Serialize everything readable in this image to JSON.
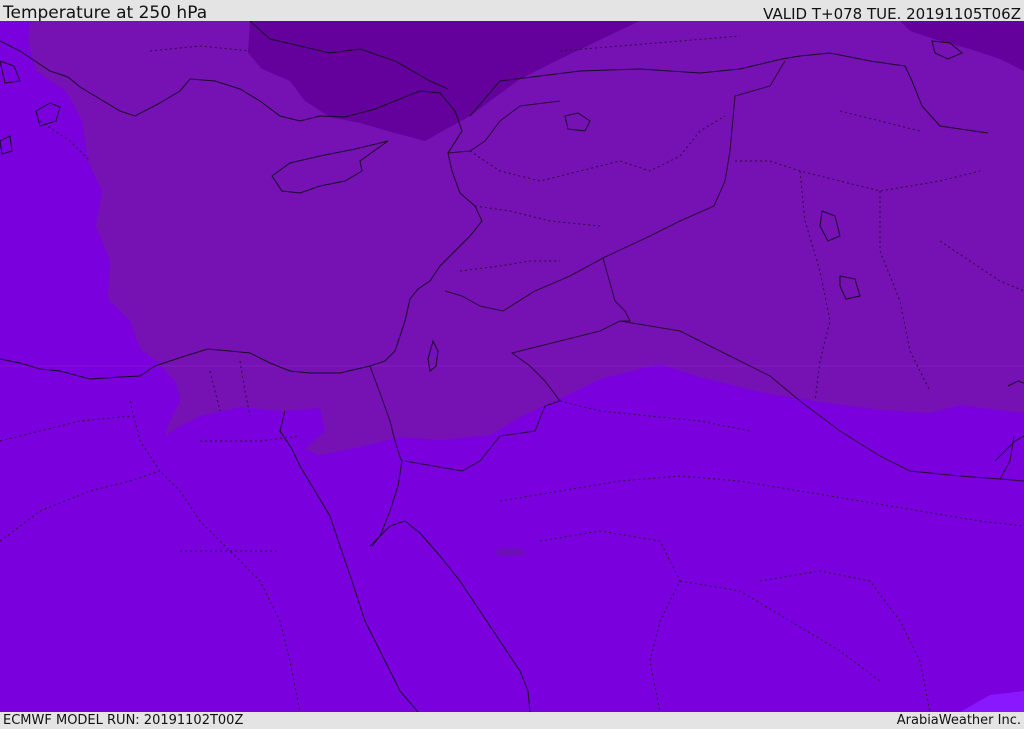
{
  "header": {
    "title": "Temperature at 250 hPa",
    "valid_time": "VALID T+078 TUE. 20191105T06Z"
  },
  "footer": {
    "model_run": "ECMWF MODEL RUN: 20191102T00Z",
    "credit": "ArabiaWeather Inc."
  },
  "map": {
    "colors": {
      "warm_band": "#7a00dd",
      "mid_band": "#7612b4",
      "cold_band": "#64009c",
      "warmest_band": "#8a18ff",
      "coastline": "#1a0a2a",
      "border": "#2a0a3a"
    }
  }
}
